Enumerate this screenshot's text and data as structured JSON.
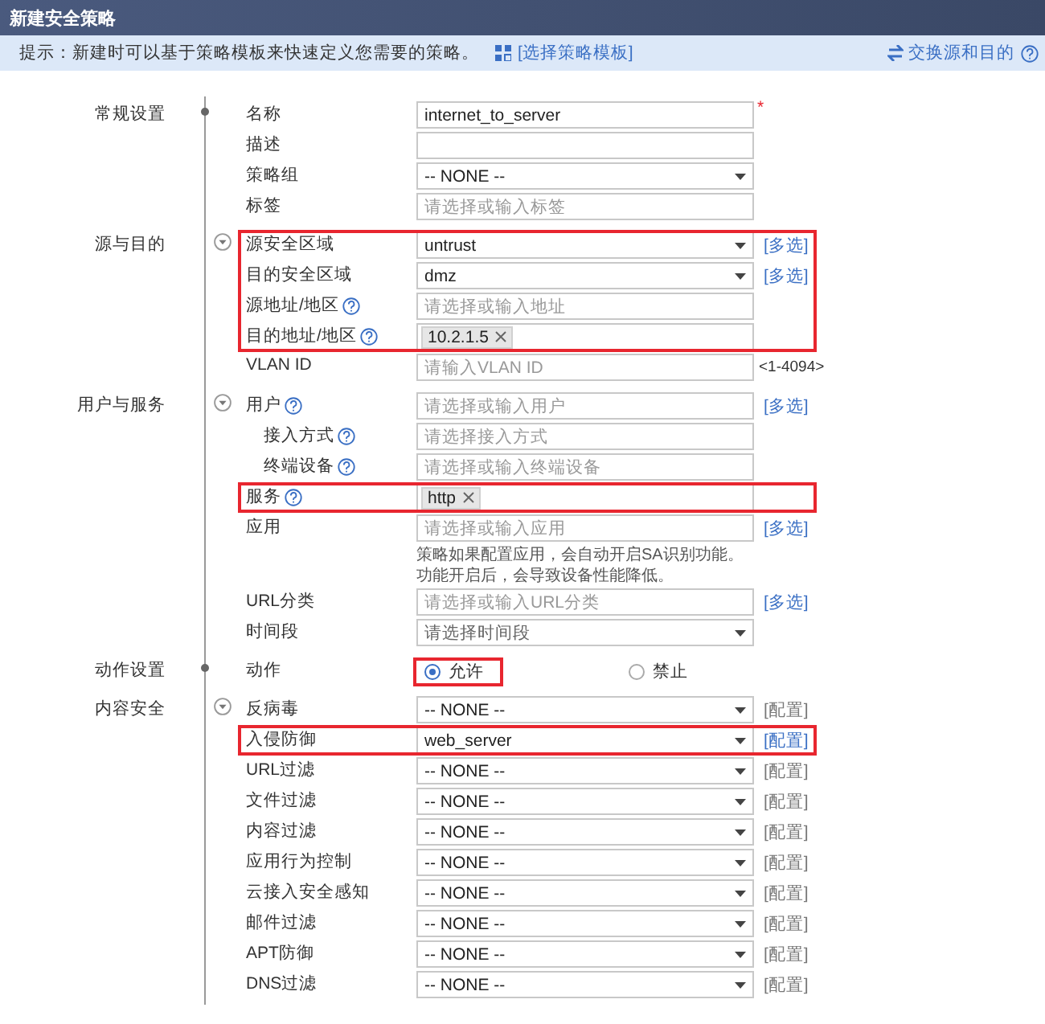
{
  "window": {
    "title": "新建安全策略"
  },
  "tip": {
    "text": "提示：新建时可以基于策略模板来快速定义您需要的策略。",
    "link": "[选择策略模板]",
    "swap": "交换源和目的"
  },
  "sections": [
    {
      "label": "常规设置",
      "collapsible": false,
      "groups": [
        {
          "highlighted": false,
          "rows": [
            {
              "kind": "input",
              "label": "名称",
              "value": "internet_to_server",
              "required_mark": "*"
            },
            {
              "kind": "input",
              "label": "描述"
            },
            {
              "kind": "select",
              "label": "策略组",
              "value": "-- NONE --"
            },
            {
              "kind": "input",
              "label": "标签",
              "placeholder": "请选择或输入标签"
            }
          ]
        }
      ]
    },
    {
      "label": "源与目的",
      "collapsible": true,
      "groups": [
        {
          "highlighted": true,
          "rows": [
            {
              "kind": "select",
              "label": "源安全区域",
              "value": "untrust",
              "link": {
                "text": "[多选]",
                "disabled": false
              }
            },
            {
              "kind": "select",
              "label": "目的安全区域",
              "value": "dmz",
              "link": {
                "text": "[多选]",
                "disabled": false
              }
            },
            {
              "kind": "input",
              "label": "源地址/地区",
              "help": true,
              "placeholder": "请选择或输入地址"
            },
            {
              "kind": "tags",
              "label": "目的地址/地区",
              "help": true,
              "tags": [
                "10.2.1.5"
              ]
            }
          ]
        },
        {
          "highlighted": false,
          "rows": [
            {
              "kind": "input",
              "label": "VLAN ID",
              "placeholder": "请输入VLAN ID",
              "suffix": "<1-4094>"
            }
          ]
        }
      ]
    },
    {
      "label": "用户与服务",
      "collapsible": true,
      "groups": [
        {
          "highlighted": false,
          "rows": [
            {
              "kind": "input",
              "label": "用户",
              "help": true,
              "placeholder": "请选择或输入用户",
              "link": {
                "text": "[多选]",
                "disabled": false
              }
            },
            {
              "kind": "input",
              "label": "接入方式",
              "help": true,
              "indent": true,
              "placeholder": "请选择接入方式"
            },
            {
              "kind": "input",
              "label": "终端设备",
              "help": true,
              "indent": true,
              "placeholder": "请选择或输入终端设备"
            }
          ]
        },
        {
          "highlighted": true,
          "rows": [
            {
              "kind": "tags",
              "label": "服务",
              "help": true,
              "tags": [
                "http"
              ]
            }
          ]
        },
        {
          "highlighted": false,
          "rows": [
            {
              "kind": "input",
              "label": "应用",
              "placeholder": "请选择或输入应用",
              "link": {
                "text": "[多选]",
                "disabled": false
              }
            },
            {
              "kind": "note",
              "text": "策略如果配置应用，会自动开启SA识别功能。功能开启后，会导致设备性能降低。"
            },
            {
              "kind": "input",
              "label": "URL分类",
              "placeholder": "请选择或输入URL分类",
              "link": {
                "text": "[多选]",
                "disabled": false
              }
            },
            {
              "kind": "select",
              "label": "时间段",
              "placeholder": "请选择时间段"
            }
          ]
        }
      ]
    },
    {
      "label": "动作设置",
      "collapsible": false,
      "groups": [
        {
          "highlighted": false,
          "rows": [
            {
              "kind": "radio",
              "label": "动作",
              "options": [
                {
                  "label": "允许",
                  "selected": true,
                  "framed": true
                },
                {
                  "label": "禁止",
                  "selected": false,
                  "framed": false
                }
              ]
            }
          ]
        }
      ]
    },
    {
      "label": "内容安全",
      "collapsible": true,
      "groups": [
        {
          "highlighted": false,
          "rows": [
            {
              "kind": "select",
              "label": "反病毒",
              "value": "-- NONE --",
              "link": {
                "text": "[配置]",
                "disabled": true
              }
            }
          ]
        },
        {
          "highlighted": true,
          "rows": [
            {
              "kind": "select",
              "label": "入侵防御",
              "value": "web_server",
              "link": {
                "text": "[配置]",
                "disabled": false
              }
            }
          ]
        },
        {
          "highlighted": false,
          "rows": [
            {
              "kind": "select",
              "label": "URL过滤",
              "value": "-- NONE --",
              "link": {
                "text": "[配置]",
                "disabled": true
              }
            },
            {
              "kind": "select",
              "label": "文件过滤",
              "value": "-- NONE --",
              "link": {
                "text": "[配置]",
                "disabled": true
              }
            },
            {
              "kind": "select",
              "label": "内容过滤",
              "value": "-- NONE --",
              "link": {
                "text": "[配置]",
                "disabled": true
              }
            },
            {
              "kind": "select",
              "label": "应用行为控制",
              "value": "-- NONE --",
              "link": {
                "text": "[配置]",
                "disabled": true
              }
            },
            {
              "kind": "select",
              "label": "云接入安全感知",
              "value": "-- NONE --",
              "link": {
                "text": "[配置]",
                "disabled": true
              }
            },
            {
              "kind": "select",
              "label": "邮件过滤",
              "value": "-- NONE --",
              "link": {
                "text": "[配置]",
                "disabled": true
              }
            },
            {
              "kind": "select",
              "label": "APT防御",
              "value": "-- NONE --",
              "link": {
                "text": "[配置]",
                "disabled": true
              }
            },
            {
              "kind": "select",
              "label": "DNS过滤",
              "value": "-- NONE --",
              "link": {
                "text": "[配置]",
                "disabled": true
              }
            }
          ]
        }
      ]
    }
  ]
}
